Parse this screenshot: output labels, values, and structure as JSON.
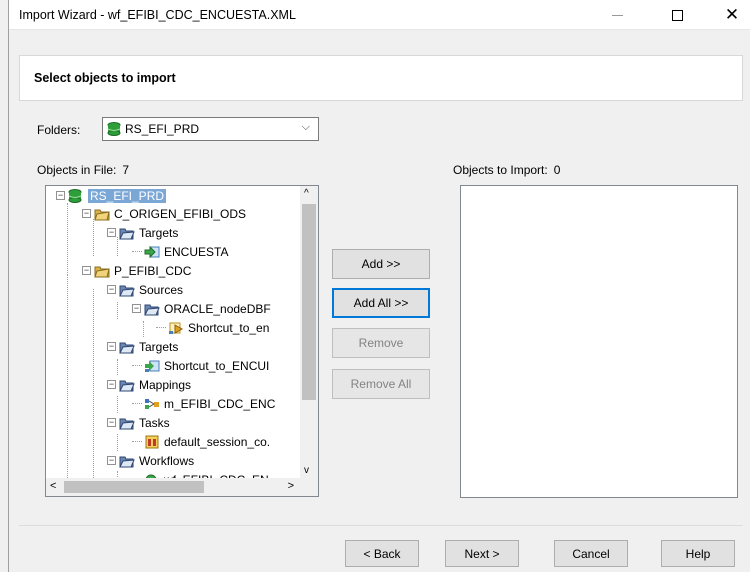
{
  "window": {
    "title": "Import Wizard - wf_EFIBI_CDC_ENCUESTA.XML"
  },
  "header": {
    "title": "Select objects to import"
  },
  "folders": {
    "label": "Folders:",
    "selected": "RS_EFI_PRD"
  },
  "objects_in_file": {
    "label": "Objects in File:",
    "count": "7"
  },
  "objects_to_import": {
    "label": "Objects to Import:",
    "count": "0"
  },
  "tree": [
    {
      "label": "RS_EFI_PRD",
      "icon": "database-icon",
      "expander": "−",
      "selected": true
    },
    {
      "label": "C_ORIGEN_EFIBI_ODS",
      "icon": "folder-icon",
      "expander": "−"
    },
    {
      "label": "Targets",
      "icon": "open-folder-icon",
      "expander": "−"
    },
    {
      "label": "ENCUESTA",
      "icon": "target-icon",
      "expander": ""
    },
    {
      "label": "P_EFIBI_CDC",
      "icon": "folder-icon",
      "expander": "−"
    },
    {
      "label": "Sources",
      "icon": "open-folder-icon",
      "expander": "−"
    },
    {
      "label": "ORACLE_nodeDBF",
      "icon": "open-folder-icon",
      "expander": "−"
    },
    {
      "label": "Shortcut_to_en",
      "icon": "shortcut-source-icon",
      "expander": ""
    },
    {
      "label": "Targets",
      "icon": "open-folder-icon",
      "expander": "−"
    },
    {
      "label": "Shortcut_to_ENCUI",
      "icon": "shortcut-target-icon",
      "expander": ""
    },
    {
      "label": "Mappings",
      "icon": "open-folder-icon",
      "expander": "−"
    },
    {
      "label": "m_EFIBI_CDC_ENC",
      "icon": "mapping-icon",
      "expander": ""
    },
    {
      "label": "Tasks",
      "icon": "open-folder-icon",
      "expander": "−"
    },
    {
      "label": "default_session_co.",
      "icon": "session-icon",
      "expander": ""
    },
    {
      "label": "Workflows",
      "icon": "open-folder-icon",
      "expander": "−"
    },
    {
      "label": "wf_EFIBI_CDC_EN",
      "icon": "workflow-icon",
      "expander": ""
    }
  ],
  "buttons": {
    "add": "Add >>",
    "add_all": "Add All >>",
    "remove": "Remove",
    "remove_all": "Remove All"
  },
  "footer": {
    "back": "< Back",
    "next": "Next >",
    "cancel": "Cancel",
    "help": "Help"
  },
  "colors": {
    "focus": "#0078d7",
    "selection": "#7aa7d6",
    "db_green": "#2e9e3a",
    "folder_gold": "#d8b24a"
  }
}
